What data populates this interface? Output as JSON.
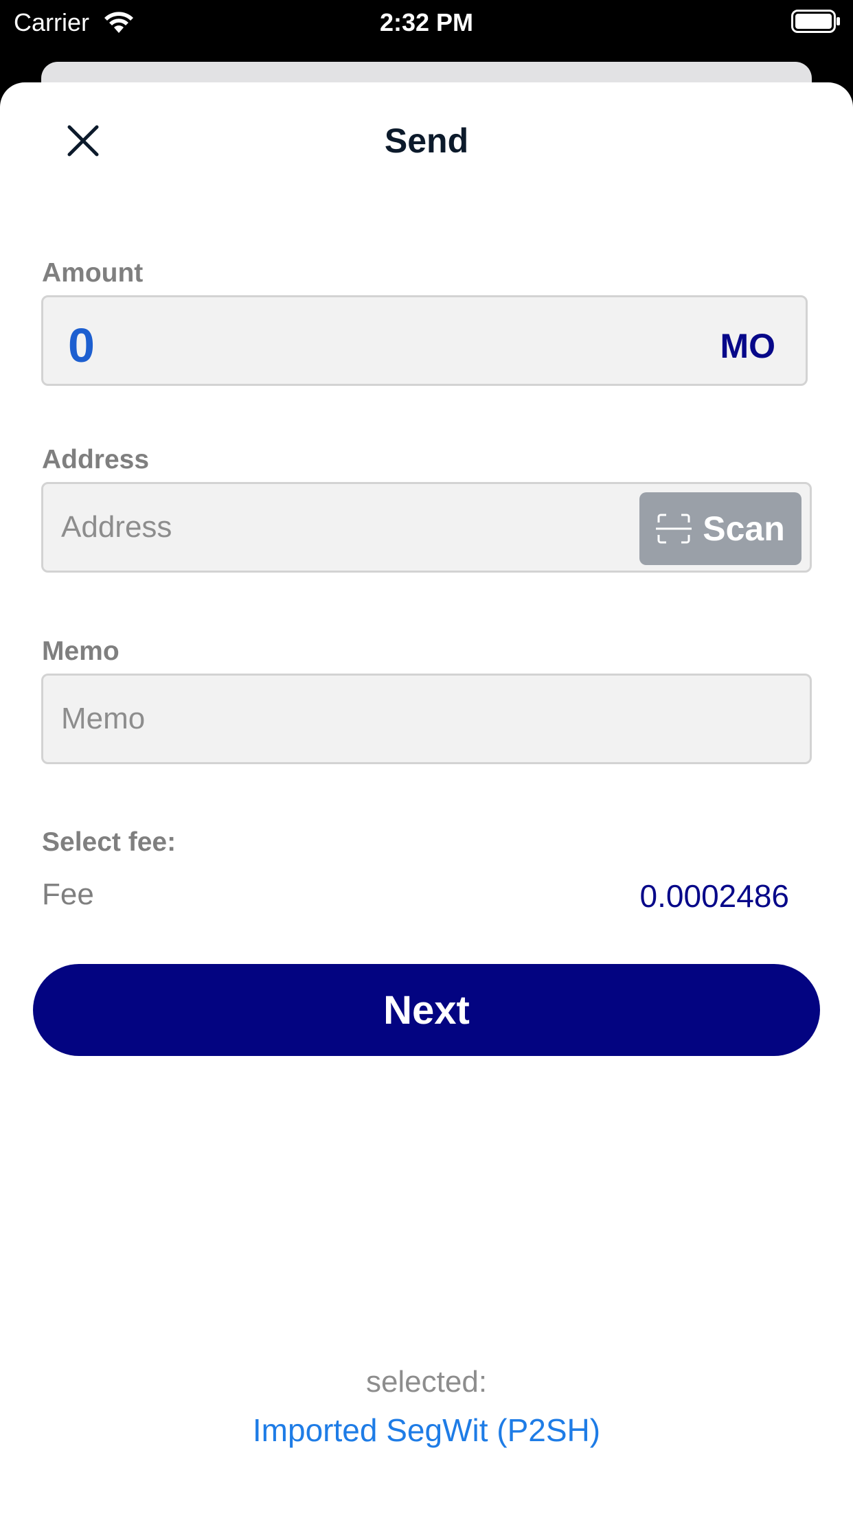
{
  "status_bar": {
    "carrier": "Carrier",
    "time": "2:32 PM",
    "wifi_icon": "wifi-icon",
    "battery_icon": "battery-icon"
  },
  "header": {
    "title": "Send",
    "close_icon": "close-icon"
  },
  "amount": {
    "label": "Amount",
    "value": "0",
    "unit": "MO"
  },
  "address": {
    "label": "Address",
    "placeholder": "Address",
    "scan_label": "Scan",
    "scan_icon": "scan-icon"
  },
  "memo": {
    "label": "Memo",
    "placeholder": "Memo"
  },
  "fee": {
    "section_label": "Select fee:",
    "label": "Fee",
    "value": "0.0002486"
  },
  "next_button": {
    "label": "Next"
  },
  "footer": {
    "selected_caption": "selected:",
    "wallet_name": "Imported SegWit (P2SH)"
  },
  "colors": {
    "accent": "#030481",
    "amount_text": "#1d5fd0",
    "link": "#1e7ce6",
    "scan_button": "#9aa0a8"
  }
}
